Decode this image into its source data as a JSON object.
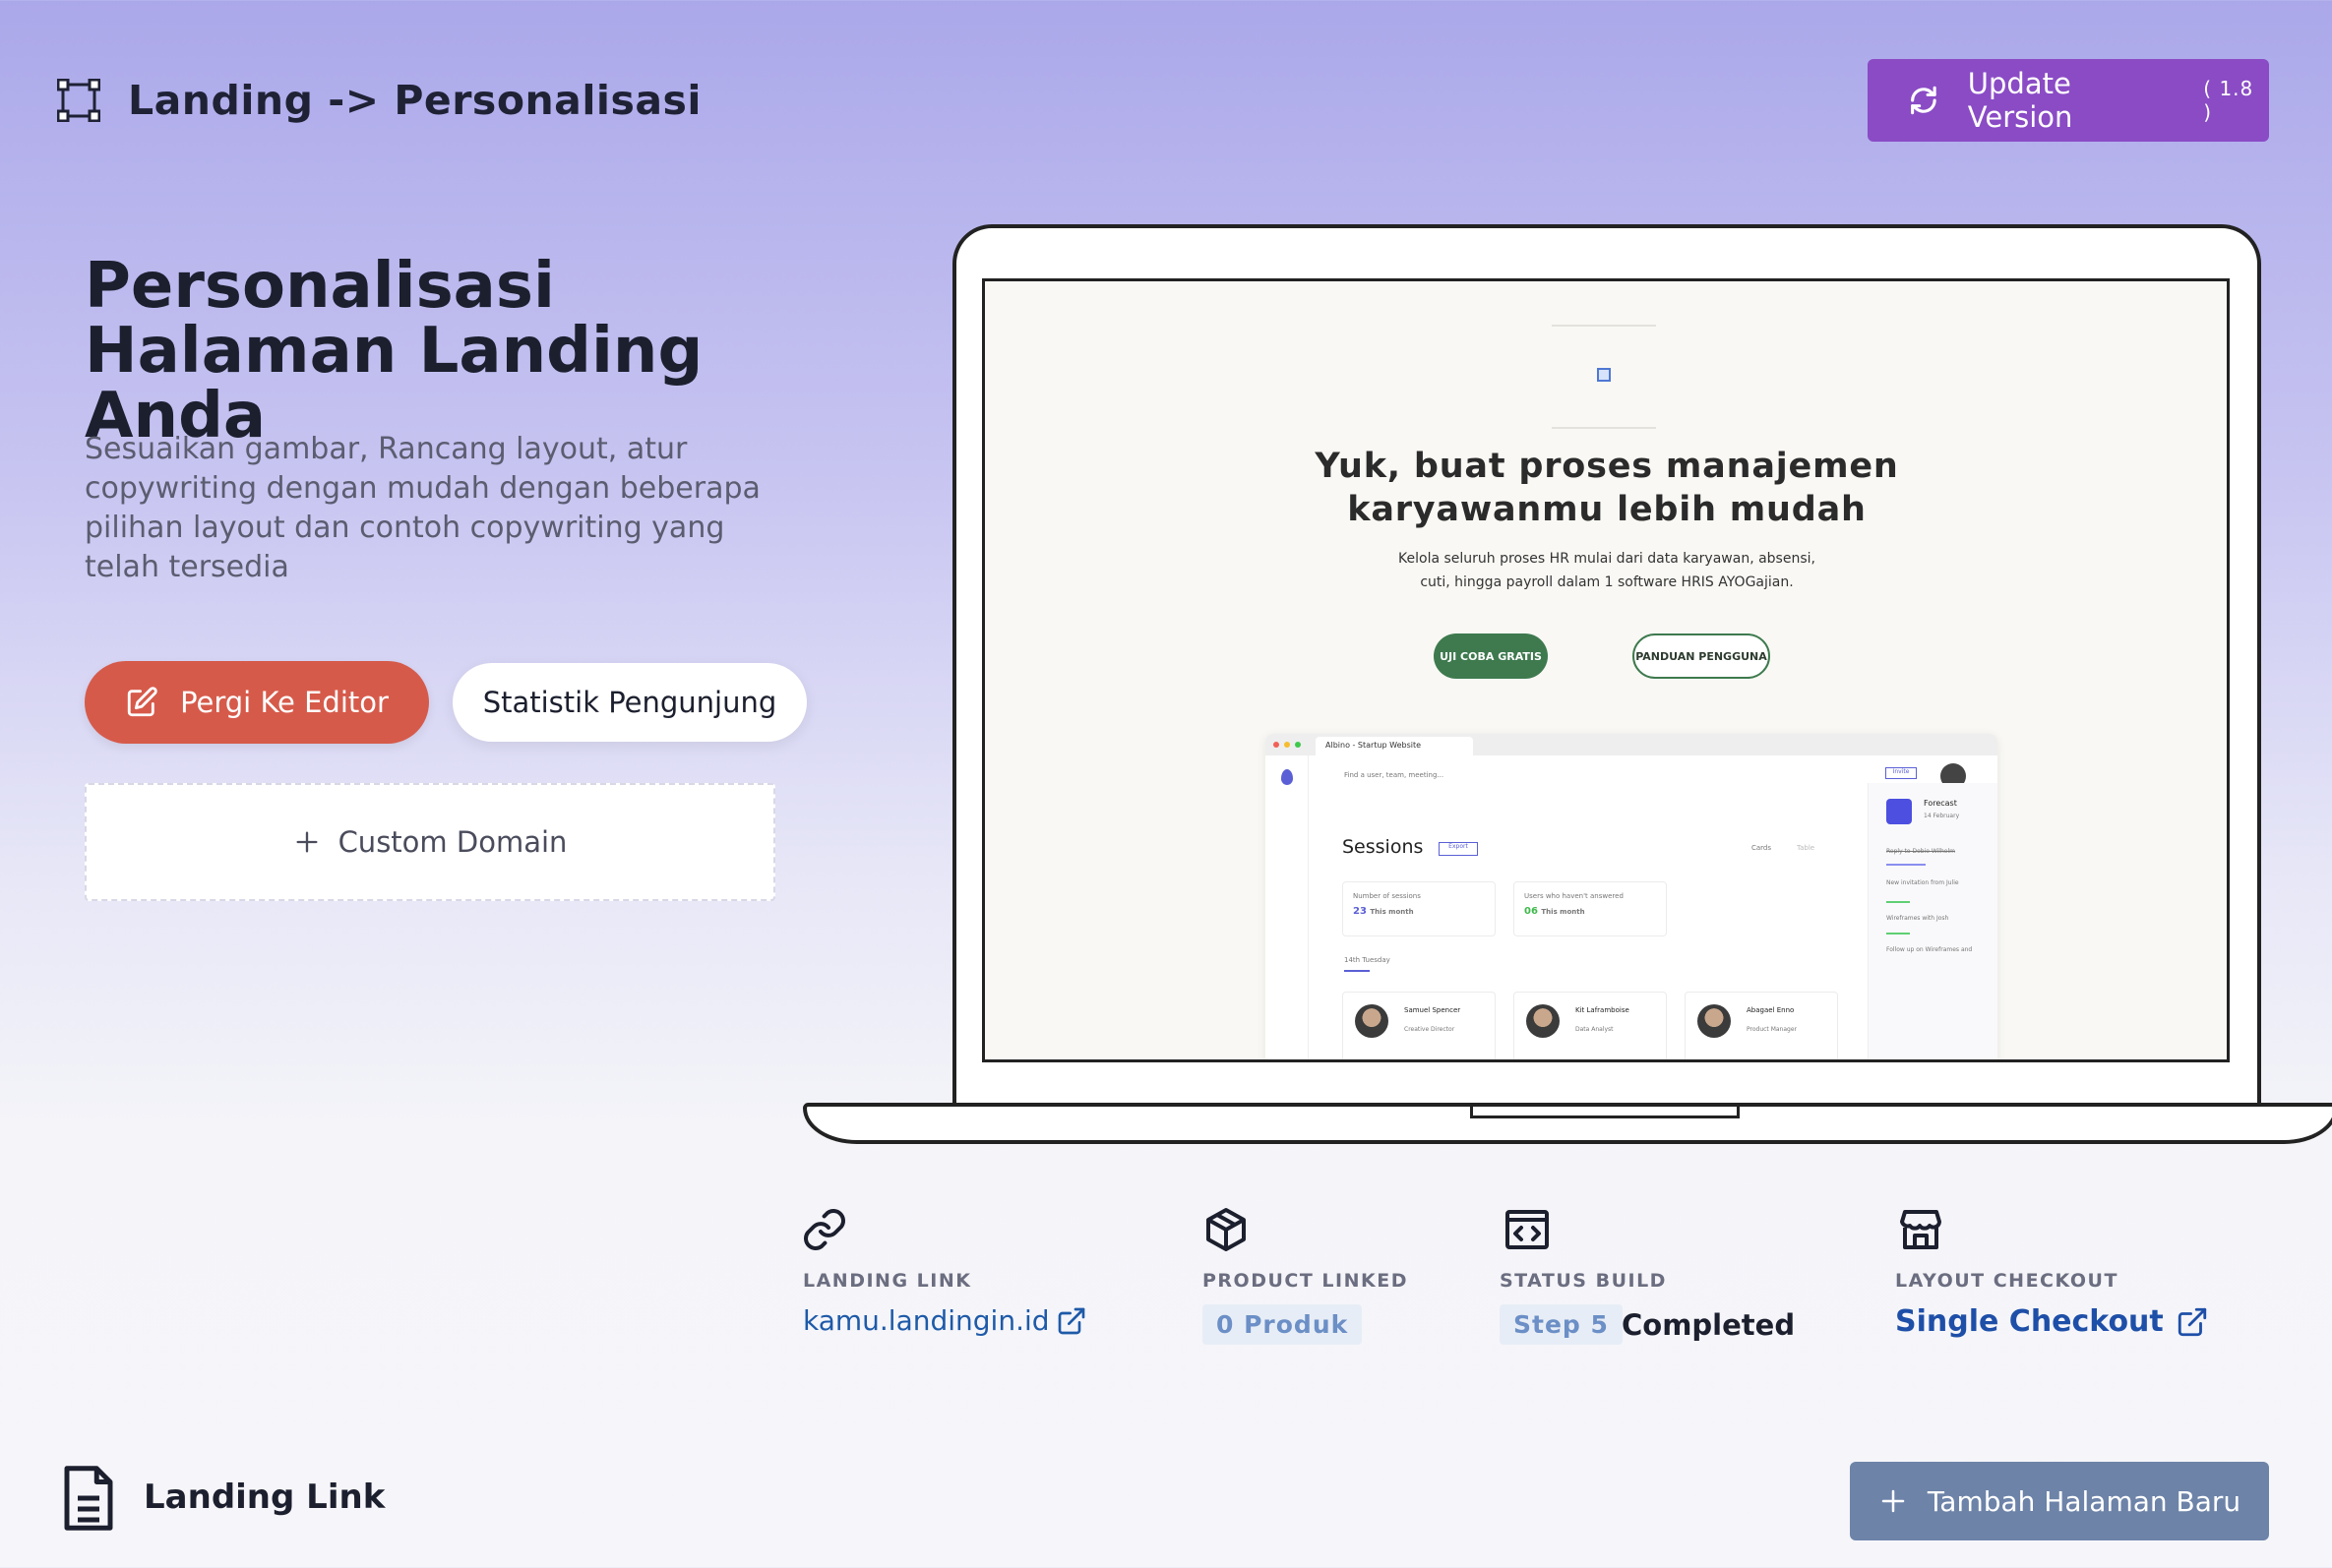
{
  "header": {
    "title": "Landing -> Personalisasi",
    "update_label": "Update Version",
    "version": "( 1.8 )"
  },
  "hero": {
    "title": "Personalisasi Halaman Landing Anda",
    "description": "Sesuaikan gambar, Rancang layout, atur copywriting dengan mudah dengan beberapa pilihan layout dan contoh copywriting yang telah tersedia",
    "editor_button": "Pergi Ke Editor",
    "stats_button": "Statistik Pengunjung",
    "custom_domain": "Custom Domain"
  },
  "preview": {
    "headline_line1": "Yuk, buat proses manajemen",
    "headline_line2": "karyawanmu lebih mudah",
    "sub_line1": "Kelola seluruh proses HR mulai dari data karyawan, absensi,",
    "sub_line2": "cuti, hingga payroll dalam 1 software HRIS AYOGajian.",
    "cta_primary": "UJI COBA GRATIS",
    "cta_secondary": "PANDUAN PENGGUNA",
    "mini_tab": "Albino - Startup Website",
    "mini_search": "Find a user, team, meeting...",
    "mini_sessions": "Sessions",
    "mini_export": "Export",
    "mini_cards": "Cards",
    "mini_table": "Table",
    "mini_stat1_label": "Number of sessions",
    "mini_stat1_value": "23",
    "mini_stat1_period": "This month",
    "mini_stat2_label": "Users who haven't answered",
    "mini_stat2_value": "06",
    "mini_stat2_period": "This month",
    "mini_day": "14th Tuesday",
    "mini_person1": "Samuel Spencer",
    "mini_person1_role": "Creative Director",
    "mini_person2": "Kit Laframboise",
    "mini_person2_role": "Data Analyst",
    "mini_person3": "Abagael Enno",
    "mini_person3_role": "Product Manager",
    "mini_forecast": "Forecast",
    "mini_forecast_date": "14 February",
    "mini_invite": "Invite",
    "mini_item1": "Reply to Dobie Wilhelm",
    "mini_item2": "New invitation from Julie",
    "mini_item3": "Wireframes with Josh",
    "mini_item4": "Follow up on Wireframes and"
  },
  "info": {
    "landing_link_label": "LANDING LINK",
    "landing_link_value": "kamu.landingin.id",
    "product_label": "PRODUCT LINKED",
    "product_value": "0 Produk",
    "status_label": "STATUS BUILD",
    "status_step": "Step 5",
    "status_value": "Completed",
    "checkout_label": "LAYOUT CHECKOUT",
    "checkout_value": "Single Checkout"
  },
  "footer": {
    "title": "Landing Link",
    "add_button": "Tambah Halaman Baru"
  },
  "colors": {
    "update_button": "#8a4bc5",
    "editor_button": "#d65a4a",
    "add_button": "#6d83a8",
    "link": "#1e5aa8",
    "site_green": "#3e7a4e"
  }
}
